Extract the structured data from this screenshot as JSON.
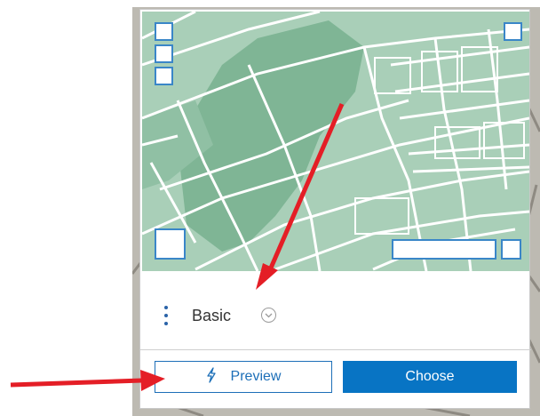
{
  "card": {
    "name_label": "Basic",
    "menu_icon": "kebab-menu-icon",
    "expand_icon": "chevron-circle-icon"
  },
  "buttons": {
    "preview_label": "Preview",
    "preview_icon": "lightning-bolt-icon",
    "choose_label": "Choose"
  },
  "colors": {
    "accent": "#0874c4",
    "map_green": "#a9cfb8",
    "annotation_arrow": "#e41e26"
  }
}
